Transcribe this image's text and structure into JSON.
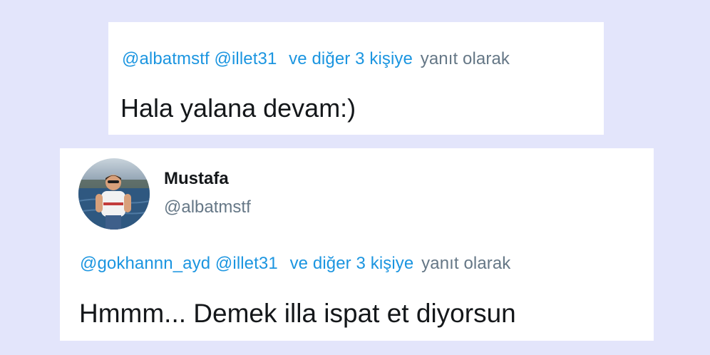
{
  "tweet_top": {
    "reply_mentions": [
      "@albatmstf",
      "@illet31"
    ],
    "reply_others": "ve diğer 3 kişiye",
    "reply_suffix": "yanıt olarak",
    "text": "Hala yalana devam:)"
  },
  "tweet_bottom": {
    "author_name": "Mustafa",
    "author_handle": "@albatmstf",
    "reply_mentions": [
      "@gokhannn_ayd",
      "@illet31"
    ],
    "reply_others": "ve diğer 3 kişiye",
    "reply_suffix": "yanıt olarak",
    "text": "Hmmm... Demek illa ispat et diyorsun"
  },
  "colors": {
    "background": "#e3e5fb",
    "link": "#1b95e0",
    "muted": "#657786",
    "text": "#14171a"
  }
}
